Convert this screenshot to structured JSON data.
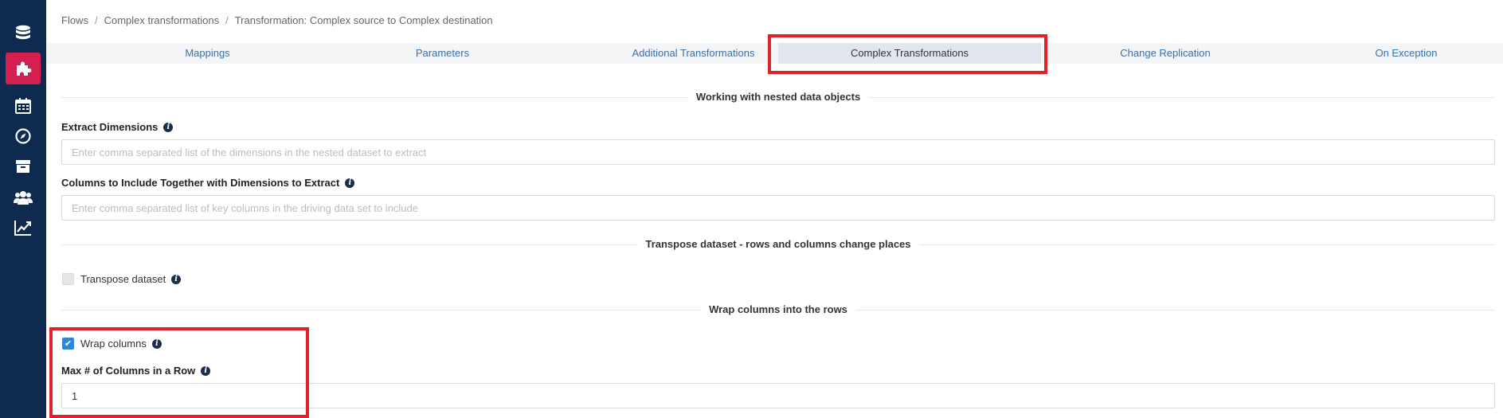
{
  "sidebar": {
    "items": [
      {
        "icon": "database-icon"
      },
      {
        "icon": "puzzle-icon",
        "active": true
      },
      {
        "icon": "calendar-icon"
      },
      {
        "icon": "compass-icon"
      },
      {
        "icon": "archive-icon"
      },
      {
        "icon": "users-icon"
      },
      {
        "icon": "chart-line-icon"
      }
    ],
    "active_color": "#d41f4f",
    "background": "#0e2a4f"
  },
  "breadcrumb": {
    "items": [
      "Flows",
      "Complex transformations",
      "Transformation: Complex source to Complex destination"
    ],
    "separator": "/"
  },
  "tabs": [
    {
      "label": "Mappings"
    },
    {
      "label": "Parameters"
    },
    {
      "label": "Additional Transformations"
    },
    {
      "label": "Complex Transformations",
      "active": true
    },
    {
      "label": "Change Replication"
    },
    {
      "label": "On Exception"
    }
  ],
  "sections": {
    "nested": {
      "title": "Working with nested data objects"
    },
    "transpose": {
      "title": "Transpose dataset - rows and columns change places"
    },
    "wrap": {
      "title": "Wrap columns into the rows"
    }
  },
  "fields": {
    "extract_dimensions": {
      "label": "Extract Dimensions",
      "placeholder": "Enter comma separated list of the dimensions in the nested dataset to extract",
      "value": ""
    },
    "columns_include": {
      "label": "Columns to Include Together with Dimensions to Extract",
      "placeholder": "Enter comma separated list of key columns in the driving data set to include",
      "value": ""
    },
    "transpose_dataset": {
      "label": "Transpose dataset",
      "checked": false
    },
    "wrap_columns": {
      "label": "Wrap columns",
      "checked": true
    },
    "max_columns": {
      "label": "Max # of Columns in a Row",
      "value": "1"
    }
  },
  "colors": {
    "highlight_border": "#e0222b",
    "link": "#3a6fa8",
    "checkbox_on": "#2f86d6"
  }
}
